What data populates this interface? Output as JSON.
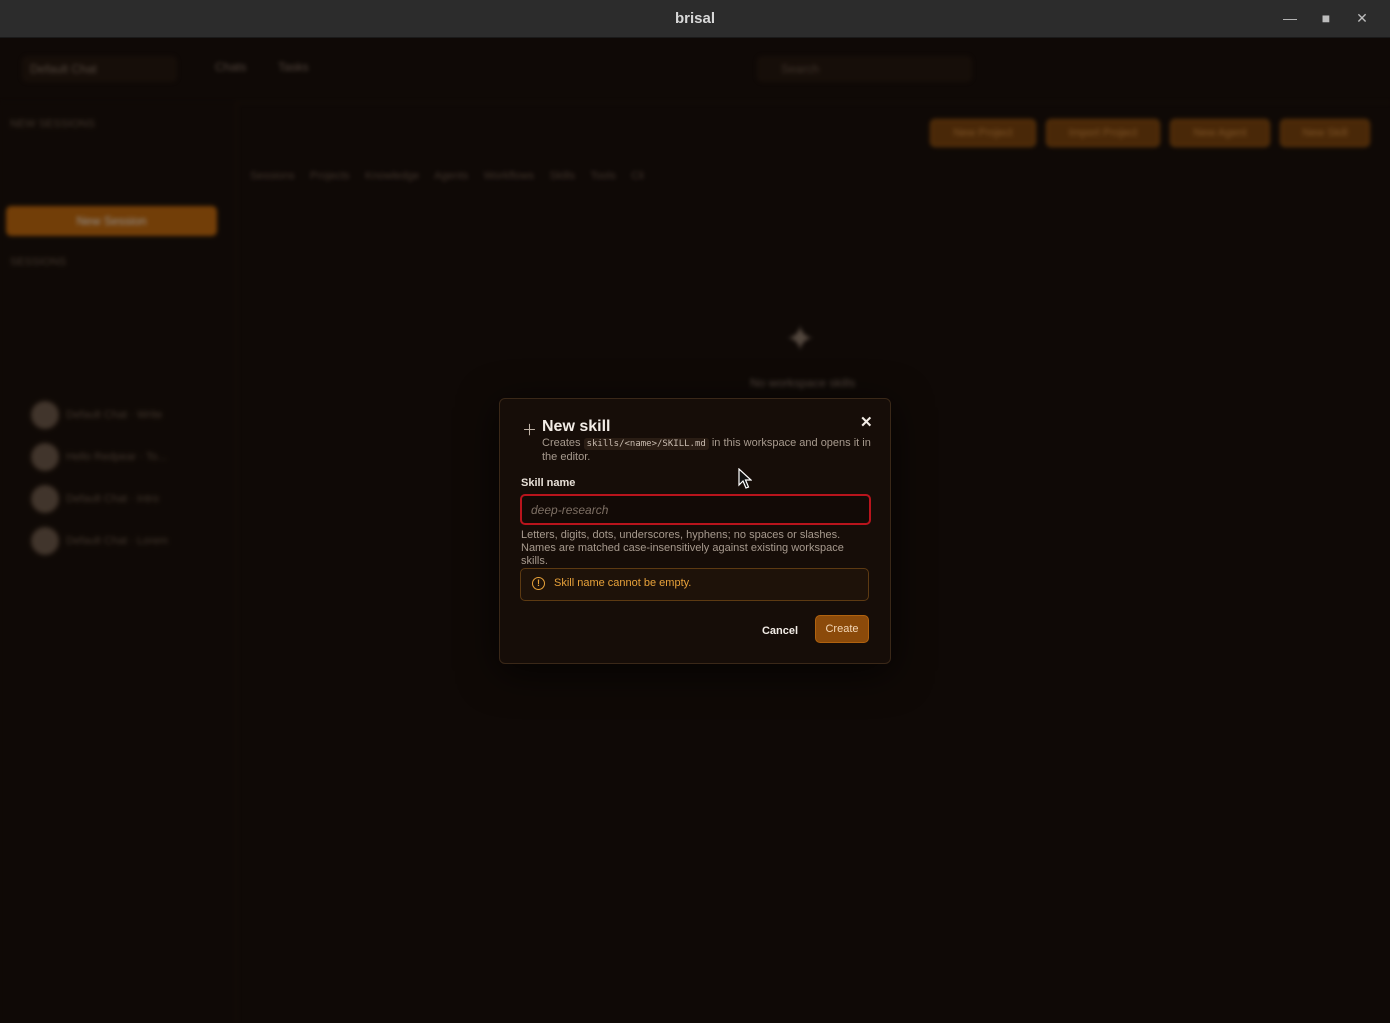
{
  "window": {
    "title": "brisal"
  },
  "background": {
    "workspace": "Default Chat",
    "nav": [
      "Chats",
      "Tasks"
    ],
    "search_placeholder": "Search",
    "sidebar": {
      "section_title": "NEW SESSIONS",
      "new_session_label": "New Session",
      "sessions_title": "SESSIONS",
      "chats": [
        "Default Chat · Write",
        "Hello Redpear · To...",
        "Default Chat · Intro",
        "Default Chat · Lorem"
      ]
    },
    "header_buttons": [
      "New Project",
      "Import Project",
      "New Agent",
      "New Skill"
    ],
    "tabs": [
      "Sessions",
      "Projects",
      "Knowledge",
      "Agents",
      "Workflows",
      "Skills",
      "Tools",
      "Cli"
    ],
    "empty_state": "No workspace skills"
  },
  "modal": {
    "title": "New skill",
    "subtitle_before": "Creates ",
    "subtitle_code": "skills/<name>/SKILL.md",
    "subtitle_after": " in this workspace and opens it in the editor.",
    "field_label": "Skill name",
    "field_value": "",
    "field_placeholder": "deep-research",
    "help_text": "Letters, digits, dots, underscores, hyphens; no spaces or slashes. Names are matched case-insensitively against existing workspace skills.",
    "error_text": "Skill name cannot be empty.",
    "cancel_label": "Cancel",
    "create_label": "Create",
    "close_icon": "close-icon",
    "plus_icon": "plus-icon"
  },
  "colors": {
    "accent": "#c46a0a",
    "error_border": "#b8141c",
    "warning": "#e8a23a"
  }
}
